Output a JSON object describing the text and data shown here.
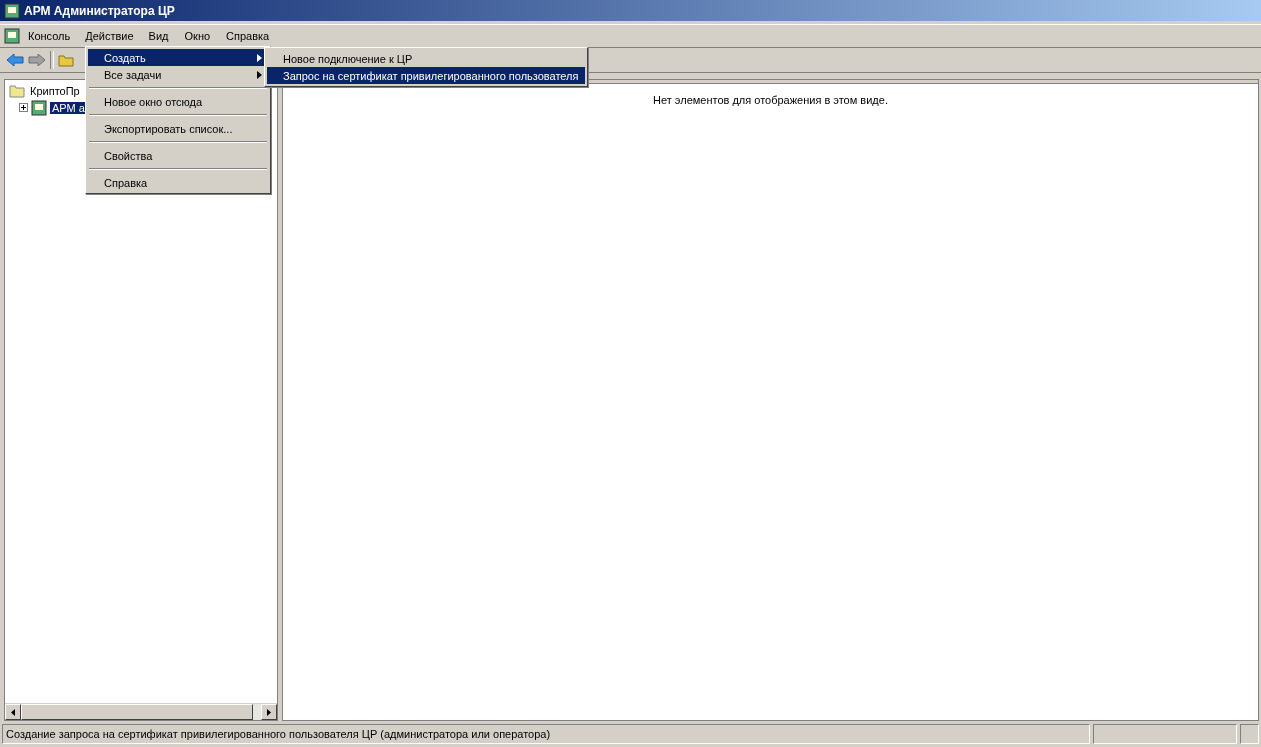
{
  "window": {
    "title": "АРМ Администратора ЦР"
  },
  "menubar": [
    {
      "label": "Консоль",
      "selected": false
    },
    {
      "label": "Действие",
      "selected": true
    },
    {
      "label": "Вид",
      "selected": false
    },
    {
      "label": "Окно",
      "selected": false
    },
    {
      "label": "Справка",
      "selected": false
    }
  ],
  "tree": [
    {
      "label": "КриптоПр",
      "selected": false,
      "children": [
        {
          "label": "АРМ а",
          "selected": true,
          "expanded": false
        }
      ]
    }
  ],
  "table": {
    "empty_message": "Нет элементов для отображения в этом виде."
  },
  "action_menu": [
    {
      "kind": "item",
      "label": "Создать",
      "submenu": true,
      "selected": true
    },
    {
      "kind": "item",
      "label": "Все задачи",
      "submenu": true,
      "selected": false
    },
    {
      "kind": "separator"
    },
    {
      "kind": "item",
      "label": "Новое окно отсюда",
      "submenu": false,
      "selected": false
    },
    {
      "kind": "separator"
    },
    {
      "kind": "item",
      "label": "Экспортировать список...",
      "submenu": false,
      "selected": false
    },
    {
      "kind": "separator"
    },
    {
      "kind": "item",
      "label": "Свойства",
      "submenu": false,
      "selected": false
    },
    {
      "kind": "separator"
    },
    {
      "kind": "item",
      "label": "Справка",
      "submenu": false,
      "selected": false
    }
  ],
  "create_submenu": [
    {
      "label": "Новое подключение к ЦР",
      "selected": false
    },
    {
      "label": "Запрос на сертификат привилегированного пользователя",
      "selected": true
    }
  ],
  "status_bar": {
    "text": "Создание запроса на сертификат привилегированного пользователя ЦР (администратора или оператора)"
  }
}
